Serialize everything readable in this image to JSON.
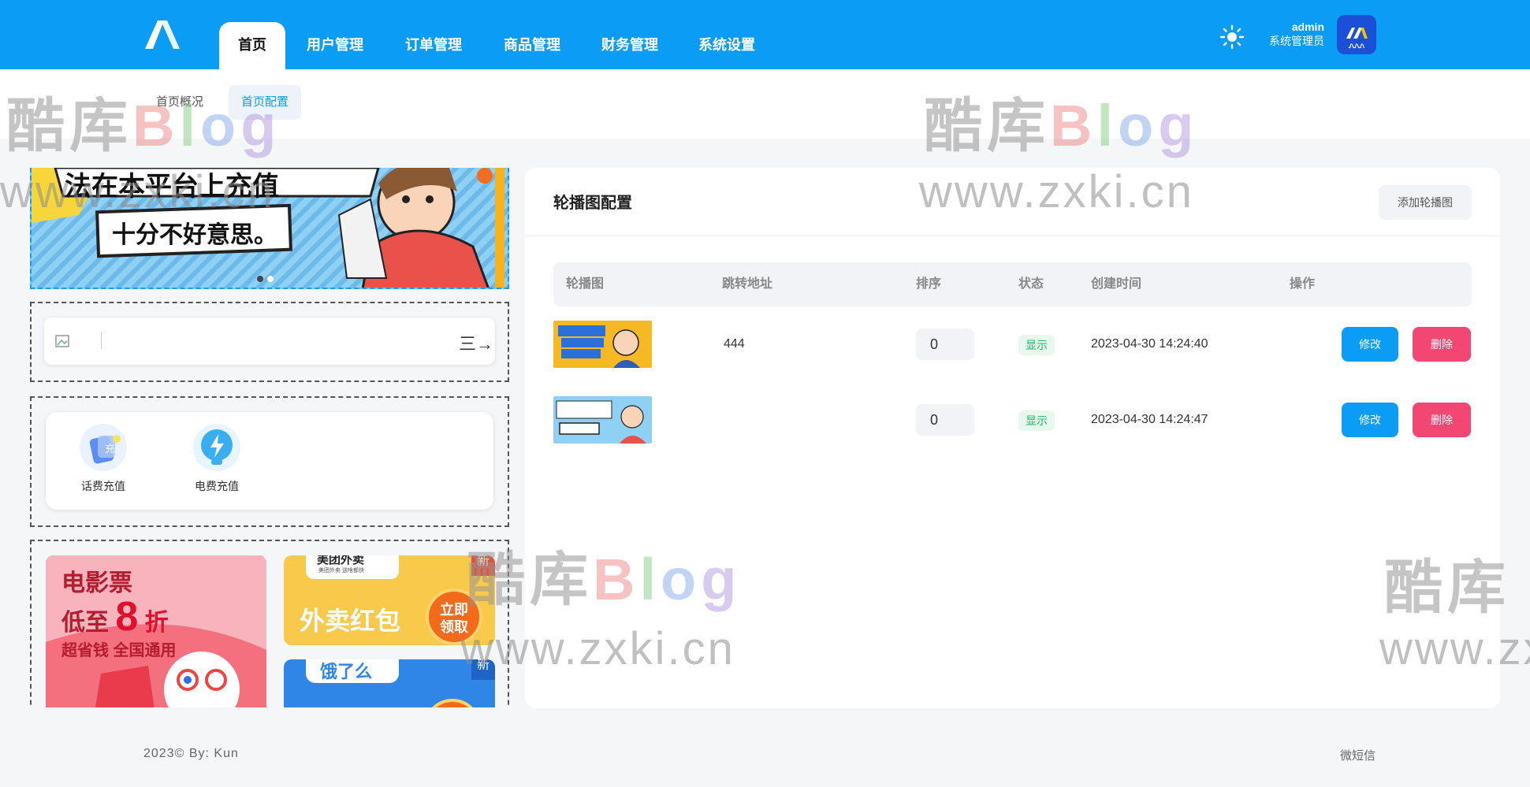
{
  "topbar": {
    "nav": [
      {
        "label": "首页",
        "active": true
      },
      {
        "label": "用户管理",
        "active": false
      },
      {
        "label": "订单管理",
        "active": false
      },
      {
        "label": "商品管理",
        "active": false
      },
      {
        "label": "财务管理",
        "active": false
      },
      {
        "label": "系统设置",
        "active": false
      }
    ],
    "user": {
      "name": "admin",
      "role": "系统管理员",
      "avatar_text": "ᏁᏁᏁ"
    },
    "theme_icon": "sun-icon",
    "accent_color": "#0b9cf5"
  },
  "subnav": [
    {
      "label": "首页概况",
      "active": false
    },
    {
      "label": "首页配置",
      "active": true
    }
  ],
  "preview": {
    "banner_text_1": "法在本平台上充值",
    "banner_text_2": "十分不好意思。",
    "notice_more": "三→",
    "shortcuts": [
      {
        "label": "话费充值",
        "icon": "phone-card-icon"
      },
      {
        "label": "电费充值",
        "icon": "lightning-icon"
      }
    ],
    "promo_movie": {
      "line1": "电影票",
      "line2a": "低至",
      "line2b": "8",
      "line2c": "折",
      "line3": "超省钱 全国通用"
    },
    "promo_takeout": {
      "brand": "美团外卖",
      "sub": "美团外卖 送啥都快",
      "title": "外卖红包",
      "button": "立即\n领取",
      "tag": "新"
    },
    "promo_eleme": {
      "brand": "饿了么",
      "tag": "新"
    }
  },
  "panel": {
    "title": "轮播图配置",
    "add_button": "添加轮播图",
    "columns": [
      "轮播图",
      "跳转地址",
      "排序",
      "状态",
      "创建时间",
      "操作"
    ],
    "rows": [
      {
        "link": "444",
        "sort": "0",
        "status": "显示",
        "created": "2023-04-30 14:24:40",
        "edit": "修改",
        "delete": "删除"
      },
      {
        "link": "",
        "sort": "0",
        "status": "显示",
        "created": "2023-04-30 14:24:47",
        "edit": "修改",
        "delete": "删除"
      }
    ],
    "danger_color": "#f24772",
    "success_color": "#19be6b"
  },
  "footer": {
    "left": "2023©  By: Kun",
    "right": "微短信"
  },
  "watermark": {
    "cn": "酷库",
    "b": "B",
    "l": "l",
    "o": "o",
    "g": "g",
    "url": "www.zxki.cn"
  }
}
